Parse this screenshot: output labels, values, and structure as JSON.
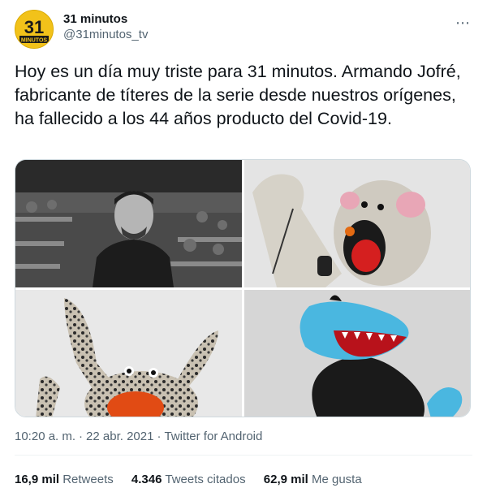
{
  "tweet": {
    "author": {
      "display_name": "31 minutos",
      "handle": "@31minutos_tv",
      "avatar_text_top": "31",
      "avatar_text_bottom": "MINUTOS"
    },
    "more_icon": "⋯",
    "text": "Hoy es un día muy triste para 31 minutos. Armando Jofré, fabricante de títeres de la serie desde nuestros orígenes, ha fallecido a los 44 años producto del Covid-19.",
    "media": [
      {
        "name": "photo-man-in-stadium"
      },
      {
        "name": "photo-mouse-puppet"
      },
      {
        "name": "photo-leopard-puppet"
      },
      {
        "name": "photo-blue-dog-puppet"
      }
    ],
    "meta": {
      "time": "10:20 a. m.",
      "date": "22 abr. 2021",
      "source": "Twitter for Android",
      "separator": "·"
    },
    "stats": {
      "retweets_count": "16,9 mil",
      "retweets_label": "Retweets",
      "quotes_count": "4.346",
      "quotes_label": "Tweets citados",
      "likes_count": "62,9 mil",
      "likes_label": "Me gusta"
    }
  },
  "colors": {
    "text": "#0f1419",
    "secondary": "#536471",
    "avatar_bg": "#f2c21a",
    "border": "#cfd9de"
  }
}
